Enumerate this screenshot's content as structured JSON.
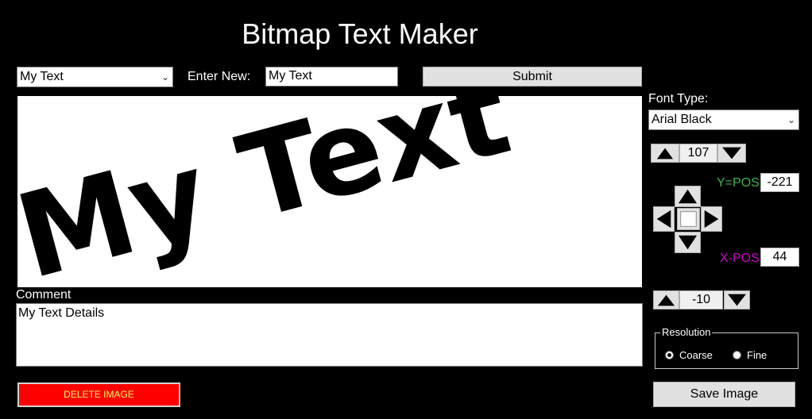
{
  "app": {
    "title": "Bitmap Text Maker"
  },
  "top_bar": {
    "preset_select_value": "My Text",
    "enter_new_label": "Enter New:",
    "enter_new_value": "My Text",
    "submit_label": "Submit"
  },
  "canvas": {
    "preview_text": "My Text"
  },
  "comment": {
    "label": "Comment",
    "value": "My Text Details"
  },
  "delete_button_label": "DELETE IMAGE",
  "font": {
    "label": "Font Type:",
    "selected": "Arial Black"
  },
  "size_control": {
    "value": "107"
  },
  "position": {
    "y_label": "Y=POS",
    "y_value": "-221",
    "x_label": "X-POS",
    "x_value": "44"
  },
  "rotation_control": {
    "value": "-10"
  },
  "resolution": {
    "legend": "Resolution",
    "options": [
      "Coarse",
      "Fine"
    ],
    "selected": "Coarse"
  },
  "save_button_label": "Save Image",
  "colors": {
    "background": "#000000",
    "delete_button": "#ff0000",
    "delete_text": "#ffff66",
    "y_label": "#3cb44b",
    "x_label": "#cc00cc"
  },
  "icons": [
    "chevron-down-icon",
    "arrow-up-icon",
    "arrow-down-icon",
    "arrow-left-icon",
    "arrow-right-icon",
    "center-square-icon"
  ]
}
